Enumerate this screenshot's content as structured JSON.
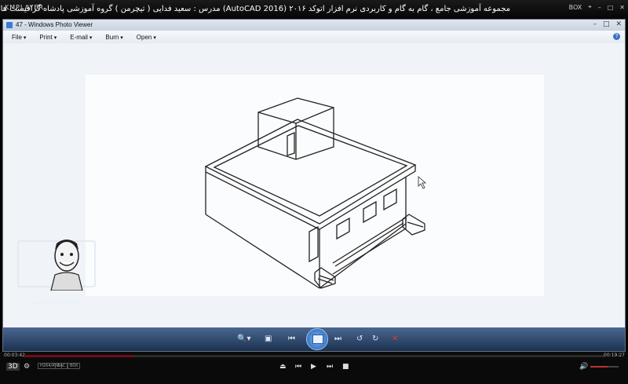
{
  "player": {
    "logo": "KMPLAYER",
    "title": "مجموعه آموزشی جامع ، گام به گام و کاربردی نرم افزار اتوکد ۲۰۱۶ (AutoCAD 2016) مدرس : سعید فدایی ( تیچرمن ) گروه آموزشی پادشاه گرافیست ها",
    "box_label": "BOX",
    "time_elapsed": "00:03:42",
    "time_total": "00:19:27",
    "progress": 0.19,
    "volume": 0.6,
    "badges": [
      "H264/AVC",
      "AAC",
      "BOX"
    ]
  },
  "viewer": {
    "title": "47 - Windows Photo Viewer",
    "menu": [
      "File",
      "Print",
      "E-mail",
      "Burn",
      "Open"
    ]
  },
  "overlay": {
    "watermark": "www.TeacherMan.ir"
  },
  "colors": {
    "toolbar": "#2a4670",
    "seek": "#6b0e18"
  }
}
